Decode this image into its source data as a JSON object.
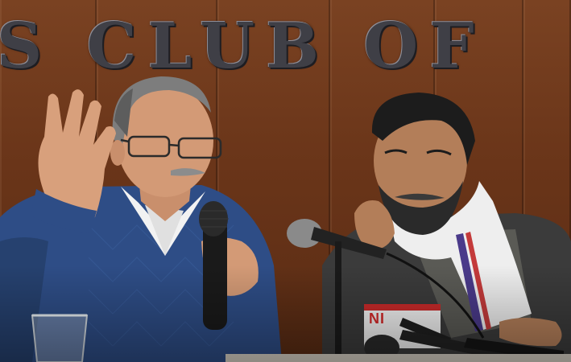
{
  "scene": {
    "description_free_text": "",
    "wall_sign_text": "S CLUB OF INDIA",
    "mic_flag_text": "NI"
  },
  "colors": {
    "wall": "#6b3a1f",
    "sign_letters": "#3f3f46",
    "sweater_left": "#2e4d86",
    "shawl_right": "#eeeeee",
    "shirt_right": "#3b3b3b",
    "mic": "#1a1a1a"
  }
}
